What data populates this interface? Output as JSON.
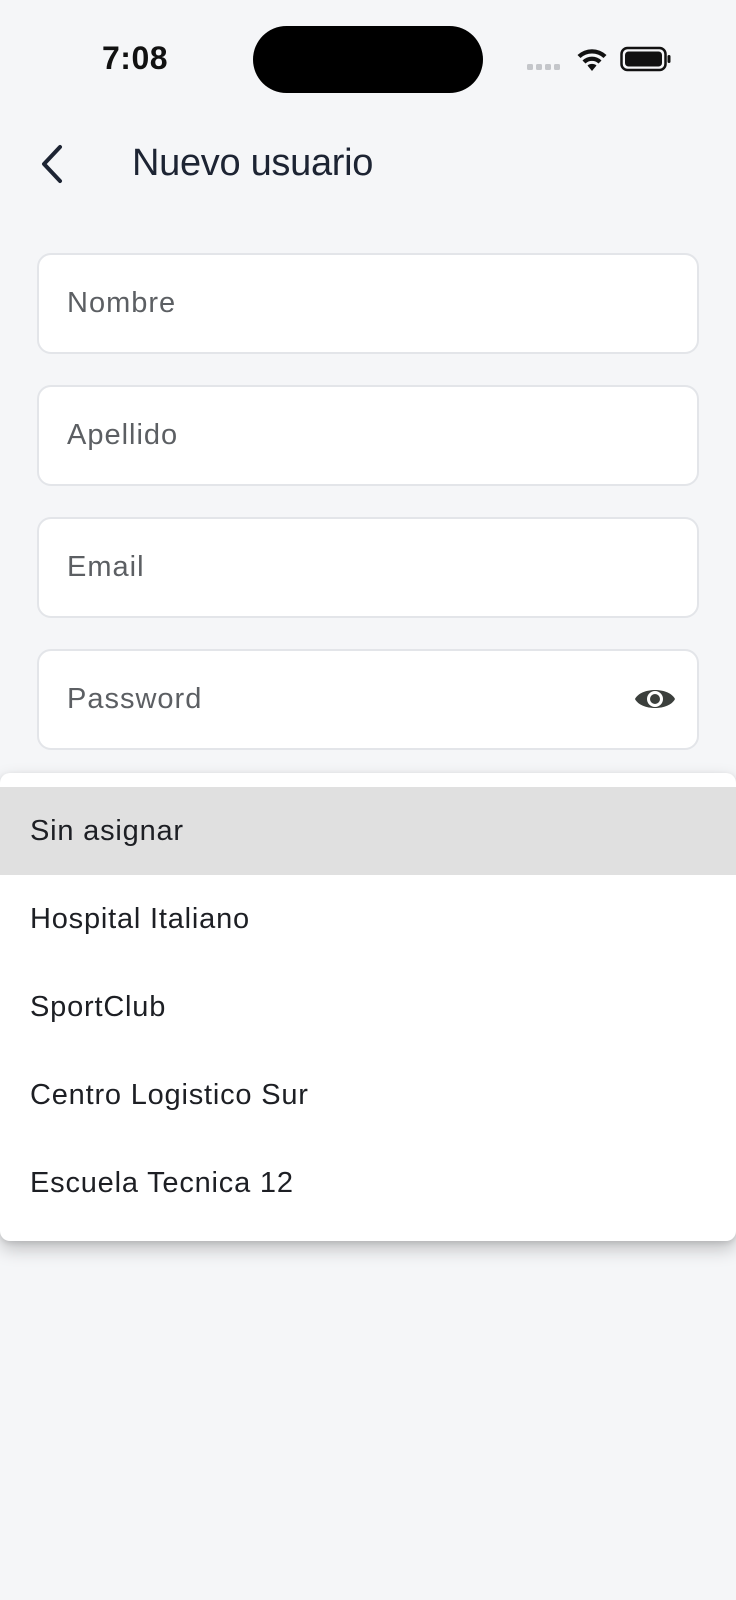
{
  "status_bar": {
    "time": "7:08"
  },
  "app_bar": {
    "title": "Nuevo usuario",
    "back_icon": "chevron-left-icon"
  },
  "form": {
    "nombre": {
      "placeholder": "Nombre",
      "value": ""
    },
    "apellido": {
      "placeholder": "Apellido",
      "value": ""
    },
    "email": {
      "placeholder": "Email",
      "value": ""
    },
    "password": {
      "placeholder": "Password",
      "value": "",
      "toggle_icon": "eye-icon"
    }
  },
  "dropdown": {
    "selected_index": 0,
    "options": [
      "Sin asignar",
      "Hospital Italiano",
      "SportClub",
      "Centro Logistico Sur",
      "Escuela Tecnica 12"
    ]
  },
  "colors": {
    "background": "#f5f6f8",
    "field_border": "#e3e5e9",
    "selected_option": "#e0e0e0",
    "text": "#1d1f24"
  }
}
